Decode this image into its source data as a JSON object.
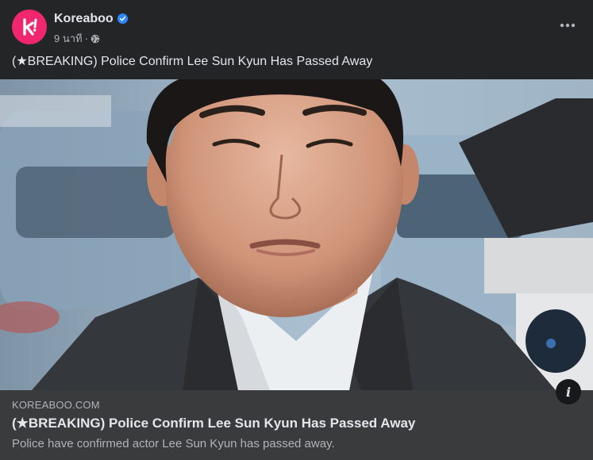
{
  "post": {
    "page_name": "Koreaboo",
    "timestamp": "9 นาที",
    "separator": "·",
    "caption": "(★BREAKING) Police Confirm Lee Sun Kyun Has Passed Away"
  },
  "icons": {
    "avatar": "koreaboo-logo-icon",
    "verified": "verified-badge-icon",
    "audience": "globe-icon",
    "more": "more-options-icon",
    "info": "info-icon"
  },
  "link_preview": {
    "domain": "KOREABOO.COM",
    "title": "(★BREAKING) Police Confirm Lee Sun Kyun Has Passed Away",
    "description": "Police have confirmed actor Lee Sun Kyun has passed away.",
    "info_label": "i"
  },
  "colors": {
    "background": "#242526",
    "link_box": "#3a3b3c",
    "brand": "#f0266e",
    "verified": "#2d88ff",
    "primary_text": "#e4e6eb",
    "secondary_text": "#b0b3b8"
  }
}
